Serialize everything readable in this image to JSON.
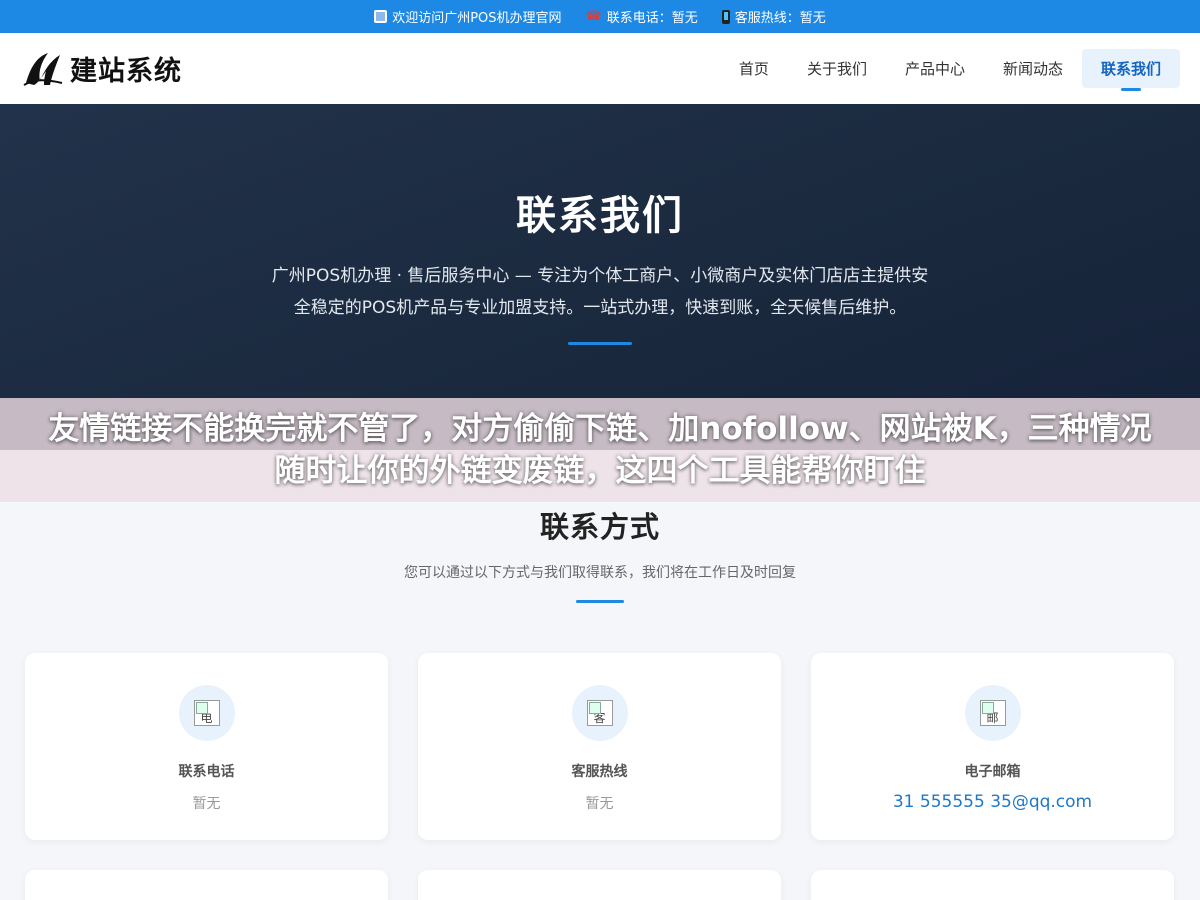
{
  "topbar": {
    "welcome": "欢迎访问广州POS机办理官网",
    "phone": "联系电话：暂无",
    "hotline": "客服热线：暂无"
  },
  "header": {
    "logo_text": "建站系统",
    "nav": [
      {
        "label": "首页"
      },
      {
        "label": "关于我们"
      },
      {
        "label": "产品中心"
      },
      {
        "label": "新闻动态"
      },
      {
        "label": "联系我们",
        "active": true
      }
    ]
  },
  "hero": {
    "title": "联系我们",
    "description": "广州POS机办理 · 售后服务中心 — 专注为个体工商户、小微商户及实体门店店主提供安全稳定的POS机产品与专业加盟支持。一站式办理，快速到账，全天候售后维护。"
  },
  "banner": {
    "title": "友情链接不能换完就不管了，对方偷偷下链、加nofollow、网站被K，三种情况随时让你的外链变废链，这四个工具能帮你盯住"
  },
  "contact": {
    "title": "联系方式",
    "subtitle": "您可以通过以下方式与我们取得联系，我们将在工作日及时回复",
    "cards": [
      {
        "label": "联系电话",
        "value": "暂无",
        "icon_alt": "电"
      },
      {
        "label": "客服热线",
        "value": "暂无",
        "icon_alt": "客"
      },
      {
        "label": "电子邮箱",
        "value": "31 555555 35@qq.com",
        "icon_alt": "邮"
      }
    ]
  },
  "colors": {
    "accent": "#1e88e5",
    "hero_bg": "#1b2a3f",
    "email_text": "#1e78c8"
  }
}
